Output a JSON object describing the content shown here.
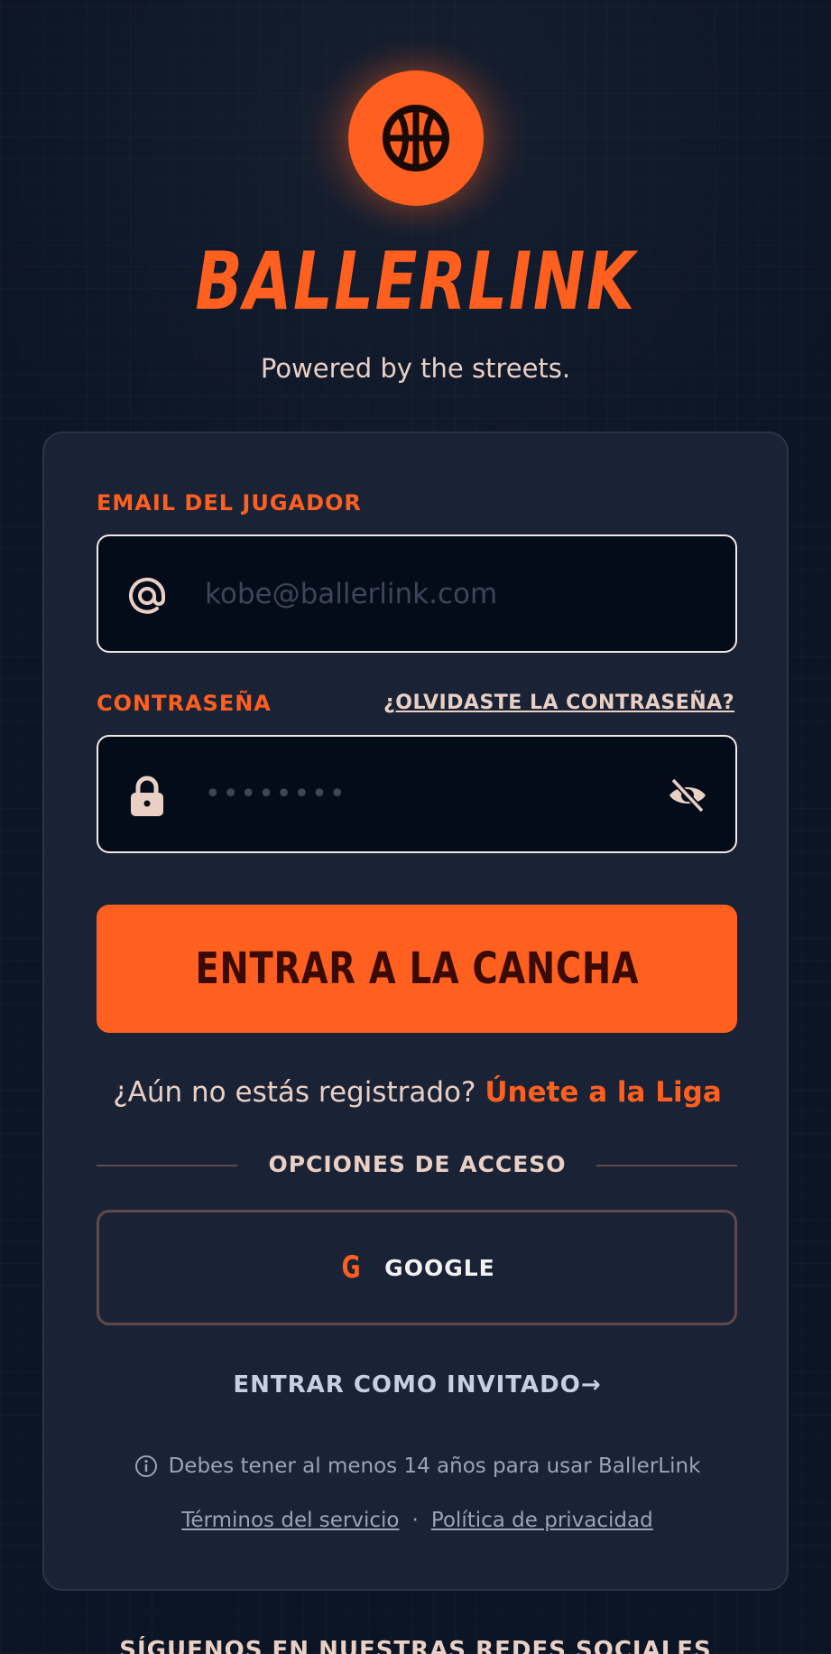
{
  "brand": {
    "name": "BALLERLINK",
    "tagline": "Powered by the streets."
  },
  "form": {
    "email_label": "EMAIL DEL JUGADOR",
    "email_placeholder": "kobe@ballerlink.com",
    "password_label": "CONTRASEÑA",
    "forgot_link": "¿OLVIDASTE LA CONTRASEÑA?",
    "password_value": "••••••••",
    "submit_label": "ENTRAR A LA CANCHA"
  },
  "register": {
    "prompt": "¿Aún no estás registrado?",
    "link": "Únete a la Liga"
  },
  "access": {
    "divider_label": "OPCIONES DE ACCESO",
    "google_glyph": "G",
    "google_label": "GOOGLE",
    "guest_label": "ENTRAR COMO INVITADO",
    "guest_arrow": "→"
  },
  "footer": {
    "age_notice": "Debes tener al menos 14 años para usar BallerLink",
    "terms_link": "Términos del servicio",
    "separator": "·",
    "privacy_link": "Política de privacidad",
    "social_heading": "SÍGUENOS EN NUESTRAS REDES SOCIALES"
  },
  "colors": {
    "accent": "#ff5f1f",
    "background": "#0c1525",
    "card": "#1a2336",
    "field": "#050c19"
  },
  "icons": {
    "logo": "basketball-icon",
    "email": "at-sign-icon",
    "password": "lock-icon",
    "visibility": "eye-off-icon",
    "notice": "info-icon"
  }
}
